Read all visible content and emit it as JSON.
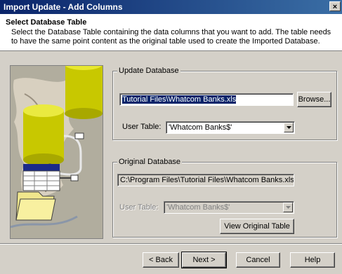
{
  "window": {
    "title": "Import Update - Add Columns",
    "close_glyph": "×"
  },
  "header": {
    "title": "Select Database Table",
    "description": "Select the Database Table containing the data columns that you want to add.  The table needs to have the same point content as the original table used to create the Imported Database."
  },
  "update_database": {
    "group_label": "Update Database",
    "file_value": "Tutorial Files\\Whatcom Banks.xls",
    "browse_label": "Browse...",
    "user_table_label": "User Table:",
    "user_table_value": "'Whatcom Banks$'"
  },
  "original_database": {
    "group_label": "Original Database",
    "file_value": "C:\\Program Files\\Tutorial Files\\Whatcom Banks.xls",
    "user_table_label": "User Table:",
    "user_table_value": "'Whatcom Banks$'",
    "view_button_label": "View Original Table"
  },
  "footer": {
    "back_label": "< Back",
    "next_label": "Next >",
    "cancel_label": "Cancel",
    "help_label": "Help"
  },
  "colors": {
    "titlebar_start": "#0a246a",
    "titlebar_end": "#3a6ea5",
    "dialog_bg": "#d4d0c8",
    "selection": "#0a246a",
    "database_cylinder": "#c8c800"
  }
}
